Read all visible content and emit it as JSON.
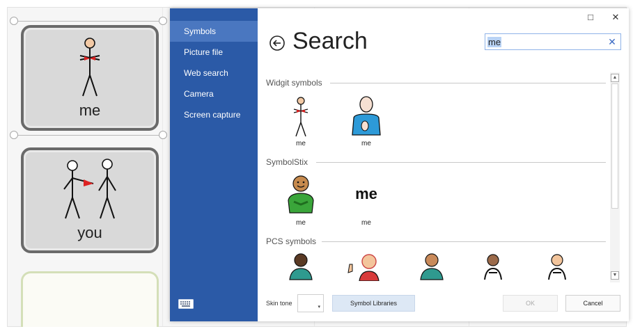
{
  "grid": {
    "cells": [
      {
        "label": "me"
      },
      {
        "label": "you"
      },
      {
        "label": ""
      }
    ]
  },
  "dialog": {
    "sidebar": {
      "items": [
        {
          "label": "Symbols",
          "active": true
        },
        {
          "label": "Picture file"
        },
        {
          "label": "Web search"
        },
        {
          "label": "Camera"
        },
        {
          "label": "Screen capture"
        }
      ],
      "keyboard_icon": "keyboard-icon"
    },
    "window_controls": {
      "maximize": "□",
      "close": "✕"
    },
    "title": "Search",
    "search": {
      "value": "me",
      "placeholder": "",
      "clear": "✕"
    },
    "groups": [
      {
        "name": "Widgit symbols",
        "symbols": [
          {
            "label": "me"
          },
          {
            "label": "me"
          }
        ]
      },
      {
        "name": "SymbolStix",
        "symbols": [
          {
            "label": "me",
            "icon": "smiling-person-icon"
          },
          {
            "label": "me",
            "text": "me"
          }
        ]
      },
      {
        "name": "PCS symbols",
        "symbols": [
          {
            "label": ""
          },
          {
            "label": ""
          },
          {
            "label": ""
          },
          {
            "label": ""
          },
          {
            "label": ""
          }
        ]
      }
    ],
    "footer": {
      "skin_tone_label": "Skin tone",
      "symbol_libraries": "Symbol Libraries",
      "ok": "OK",
      "cancel": "Cancel"
    }
  },
  "colors": {
    "sidebar": "#2b5aa7",
    "sidebar_active": "#4a77c0",
    "accent": "#3a6ac4"
  }
}
